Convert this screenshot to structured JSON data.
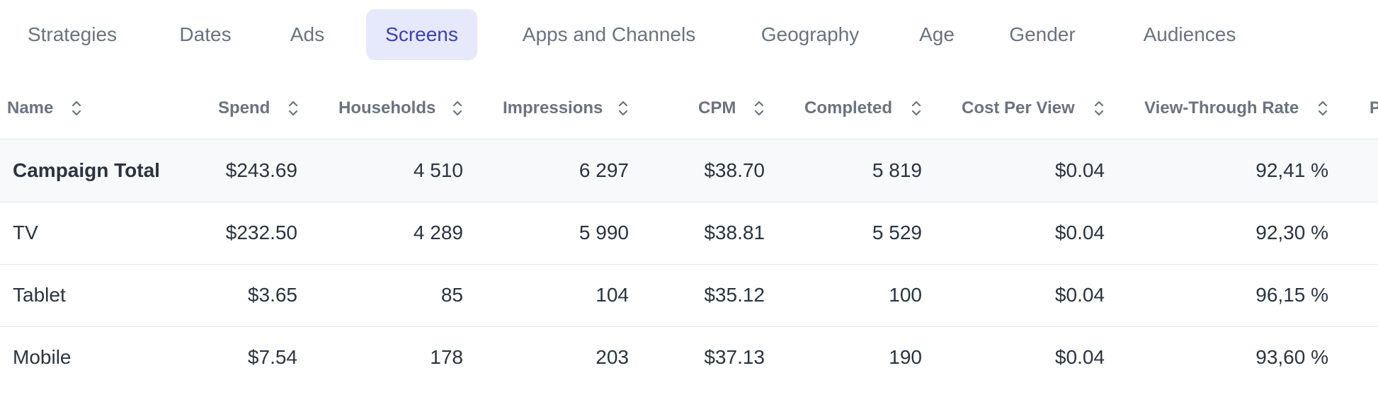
{
  "tabs": [
    {
      "label": "Strategies",
      "active": false
    },
    {
      "label": "Dates",
      "active": false
    },
    {
      "label": "Ads",
      "active": false
    },
    {
      "label": "Screens",
      "active": true
    },
    {
      "label": "Apps and Channels",
      "active": false
    },
    {
      "label": "Geography",
      "active": false
    },
    {
      "label": "Age",
      "active": false
    },
    {
      "label": "Gender",
      "active": false
    },
    {
      "label": "Audiences",
      "active": false
    }
  ],
  "table": {
    "columns": [
      "Name",
      "Spend",
      "Households",
      "Impressions",
      "CPM",
      "Completed",
      "Cost Per View",
      "View-Through Rate",
      "P"
    ],
    "sort_icon": "sort-updown-icon",
    "rows": [
      {
        "name": "Campaign Total",
        "spend": "$243.69",
        "households": "4 510",
        "impressions": "6 297",
        "cpm": "$38.70",
        "completed": "5 819",
        "cost_per_view": "$0.04",
        "vtr": "92,41 %"
      },
      {
        "name": "TV",
        "spend": "$232.50",
        "households": "4 289",
        "impressions": "5 990",
        "cpm": "$38.81",
        "completed": "5 529",
        "cost_per_view": "$0.04",
        "vtr": "92,30 %"
      },
      {
        "name": "Tablet",
        "spend": "$3.65",
        "households": "85",
        "impressions": "104",
        "cpm": "$35.12",
        "completed": "100",
        "cost_per_view": "$0.04",
        "vtr": "96,15 %"
      },
      {
        "name": "Mobile",
        "spend": "$7.54",
        "households": "178",
        "impressions": "203",
        "cpm": "$37.13",
        "completed": "190",
        "cost_per_view": "$0.04",
        "vtr": "93,60 %"
      }
    ]
  },
  "colors": {
    "active_tab_bg": "#e6e9fb",
    "active_tab_text": "#3b3fb6",
    "tab_text": "#6b7280",
    "header_text": "#6b7280",
    "total_row_bg": "#f8f9fb",
    "divider": "#e5e7eb"
  }
}
